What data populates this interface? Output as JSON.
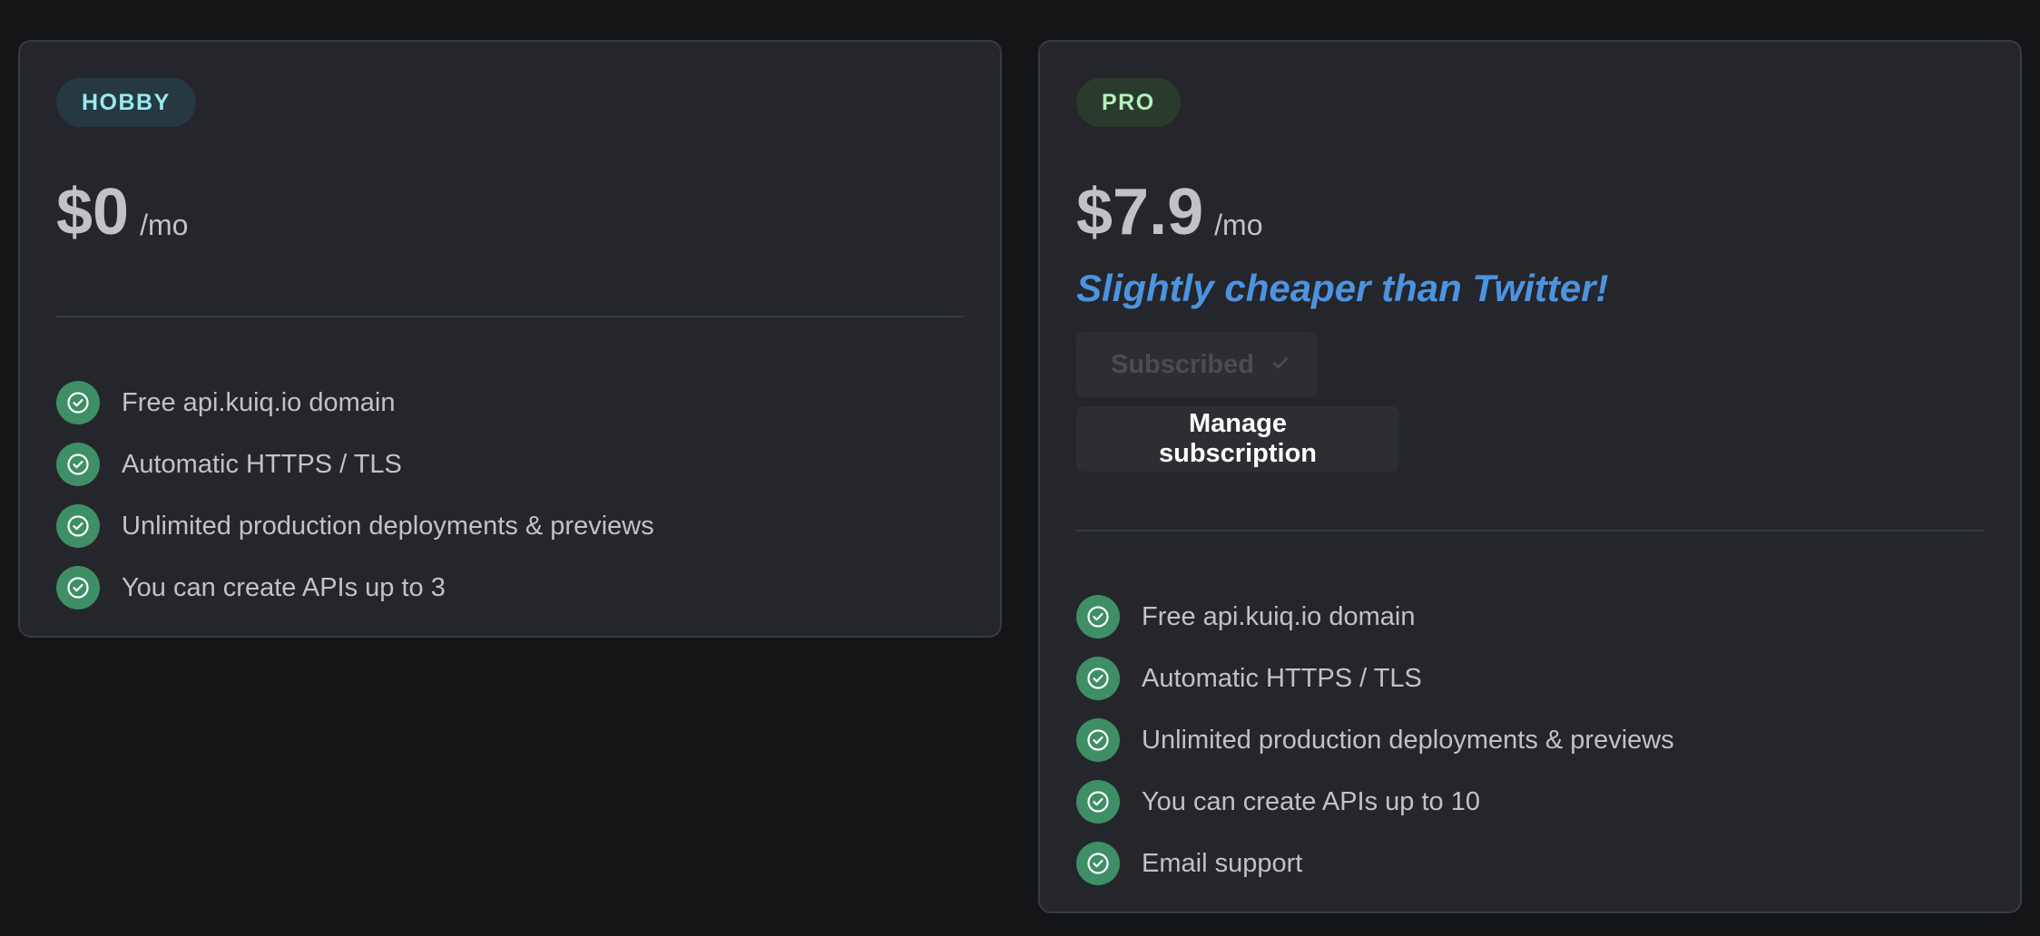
{
  "plans": [
    {
      "badge": "HOBBY",
      "price": "$0",
      "period": "/mo",
      "features": [
        "Free api.kuiq.io domain",
        "Automatic HTTPS / TLS",
        "Unlimited production deployments & previews",
        "You can create APIs up to 3"
      ]
    },
    {
      "badge": "PRO",
      "price": "$7.9",
      "period": "/mo",
      "tagline": "Slightly cheaper than Twitter!",
      "subscribed_label": "Subscribed",
      "manage_label": "Manage subscription",
      "features": [
        "Free api.kuiq.io domain",
        "Automatic HTTPS / TLS",
        "Unlimited production deployments & previews",
        "You can create APIs up to 10",
        "Email support"
      ]
    }
  ],
  "icons": {
    "feature_icon": "check-circle-icon",
    "subscribed_icon": "check-icon"
  },
  "colors": {
    "background": "#141517",
    "card": "#25262b",
    "hobby_badge_text": "#99e9f2",
    "pro_badge_text": "#b2f2bb",
    "tagline": "#4c93e0",
    "check_circle": "#3e8e66"
  }
}
